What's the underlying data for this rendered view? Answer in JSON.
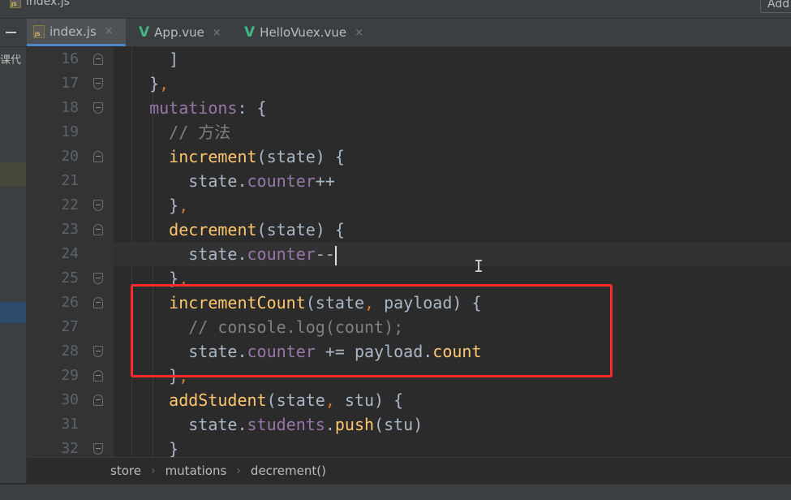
{
  "window": {
    "title_file": "index.js",
    "add_button_label": "Add"
  },
  "tabs": [
    {
      "label": "index.js",
      "icon": "js-file-icon",
      "active": true
    },
    {
      "label": "App.vue",
      "icon": "vue-file-icon",
      "active": false
    },
    {
      "label": "HelloVuex.vue",
      "icon": "vue-file-icon",
      "active": false
    }
  ],
  "tab_close_glyph": "×",
  "vue_glyph": "V",
  "left_panel": {
    "label": "课代"
  },
  "editor": {
    "line_numbers": [
      "16",
      "17",
      "18",
      "19",
      "20",
      "21",
      "22",
      "23",
      "24",
      "25",
      "26",
      "27",
      "28",
      "29",
      "30",
      "31",
      "32"
    ],
    "lines": [
      {
        "indent": "    ",
        "tokens": [
          {
            "t": "]",
            "c": "plain"
          }
        ]
      },
      {
        "indent": "  ",
        "tokens": [
          {
            "t": "}",
            "c": "plain"
          },
          {
            "t": ",",
            "c": "punc"
          }
        ]
      },
      {
        "indent": "  ",
        "tokens": [
          {
            "t": "mutations",
            "c": "prop"
          },
          {
            "t": ": {",
            "c": "plain"
          }
        ]
      },
      {
        "indent": "    ",
        "tokens": [
          {
            "t": "// 方法",
            "c": "comment"
          }
        ]
      },
      {
        "indent": "    ",
        "tokens": [
          {
            "t": "increment",
            "c": "fn"
          },
          {
            "t": "(state) {",
            "c": "plain"
          }
        ]
      },
      {
        "indent": "      ",
        "tokens": [
          {
            "t": "state.",
            "c": "plain"
          },
          {
            "t": "counter",
            "c": "prop"
          },
          {
            "t": "++",
            "c": "plain"
          }
        ]
      },
      {
        "indent": "    ",
        "tokens": [
          {
            "t": "}",
            "c": "plain"
          },
          {
            "t": ",",
            "c": "punc"
          }
        ]
      },
      {
        "indent": "    ",
        "tokens": [
          {
            "t": "decrement",
            "c": "fn"
          },
          {
            "t": "(state) {",
            "c": "plain"
          }
        ]
      },
      {
        "indent": "      ",
        "tokens": [
          {
            "t": "state.",
            "c": "plain"
          },
          {
            "t": "counter",
            "c": "prop"
          },
          {
            "t": "--",
            "c": "plain"
          }
        ],
        "caret": true
      },
      {
        "indent": "    ",
        "tokens": [
          {
            "t": "}",
            "c": "plain"
          },
          {
            "t": ",",
            "c": "punc"
          }
        ]
      },
      {
        "indent": "    ",
        "tokens": [
          {
            "t": "incrementCount",
            "c": "fn"
          },
          {
            "t": "(state",
            "c": "plain"
          },
          {
            "t": ",",
            "c": "punc"
          },
          {
            "t": " payload) {",
            "c": "plain"
          }
        ]
      },
      {
        "indent": "      ",
        "tokens": [
          {
            "t": "// console.log(count);",
            "c": "comment"
          }
        ]
      },
      {
        "indent": "      ",
        "tokens": [
          {
            "t": "state.",
            "c": "plain"
          },
          {
            "t": "counter",
            "c": "prop"
          },
          {
            "t": " += payload.",
            "c": "plain"
          },
          {
            "t": "count",
            "c": "fn"
          }
        ]
      },
      {
        "indent": "    ",
        "tokens": [
          {
            "t": "}",
            "c": "plain"
          },
          {
            "t": ",",
            "c": "punc"
          }
        ]
      },
      {
        "indent": "    ",
        "tokens": [
          {
            "t": "addStudent",
            "c": "fn"
          },
          {
            "t": "(state",
            "c": "plain"
          },
          {
            "t": ",",
            "c": "punc"
          },
          {
            "t": " stu) {",
            "c": "plain"
          }
        ]
      },
      {
        "indent": "      ",
        "tokens": [
          {
            "t": "state.",
            "c": "plain"
          },
          {
            "t": "students",
            "c": "prop"
          },
          {
            "t": ".",
            "c": "plain"
          },
          {
            "t": "push",
            "c": "fn"
          },
          {
            "t": "(stu)",
            "c": "plain"
          }
        ]
      },
      {
        "indent": "    ",
        "tokens": [
          {
            "t": "}",
            "c": "plain"
          }
        ]
      }
    ],
    "current_line_index": 8
  },
  "breadcrumb": [
    "store",
    "mutations",
    "decrement()"
  ],
  "breadcrumb_separator": "›",
  "colors": {
    "keyword_orange": "#cc7832",
    "function_yellow": "#ffc66d",
    "property_purple": "#9876aa",
    "comment_gray": "#808080",
    "highlight_red": "#ff2a2a",
    "vue_green": "#41b883"
  }
}
